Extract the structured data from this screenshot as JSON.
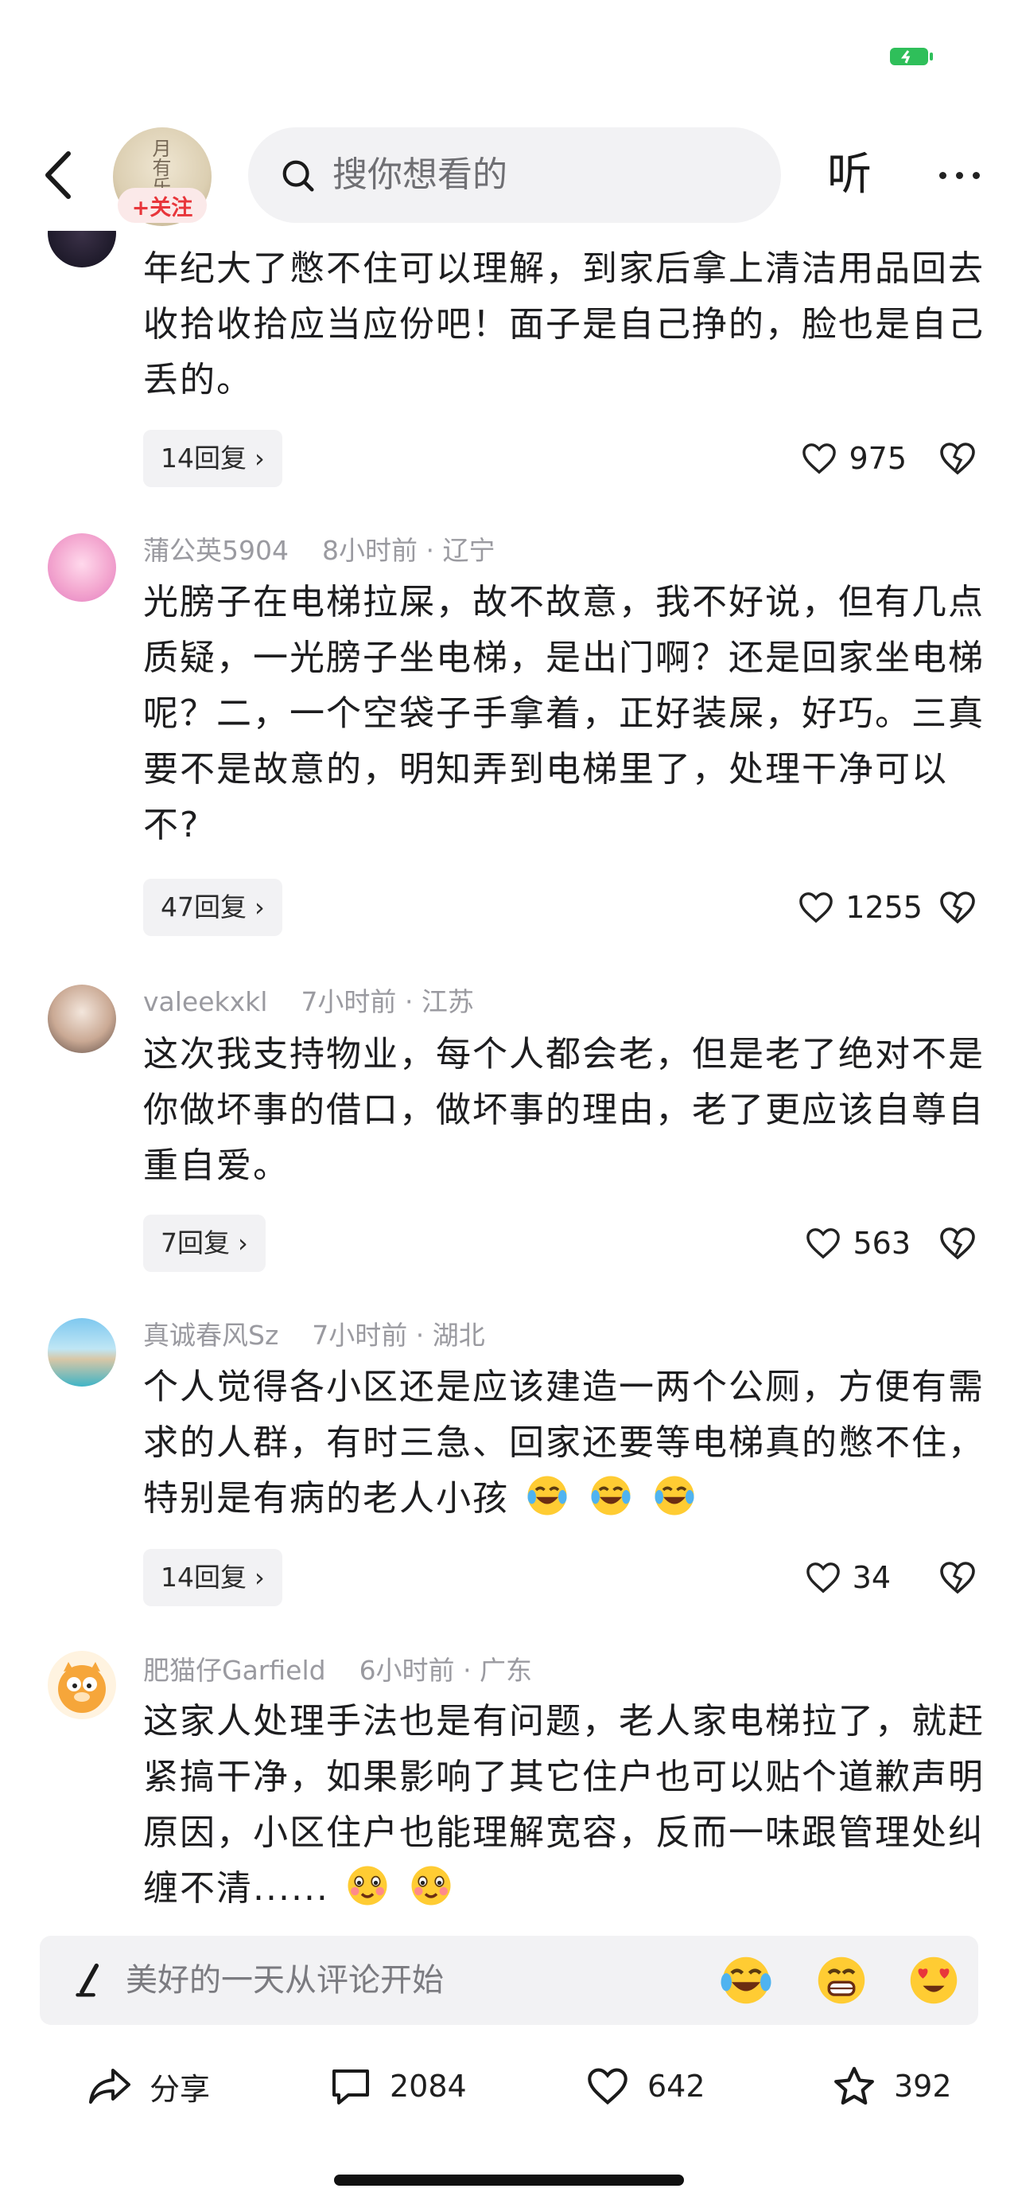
{
  "header": {
    "search_placeholder": "搜你想看的",
    "listen_label": "听",
    "follow_label": "+关注",
    "avatar_text": "月有乐"
  },
  "comments": [
    {
      "user": "",
      "time": "",
      "location": "",
      "text": "年纪大了憋不住可以理解，到家后拿上清洁用品回去收拾收拾应当应份吧！面子是自己挣的，脸也是自己丢的。",
      "replies": "14回复",
      "likes": "975"
    },
    {
      "user": "蒲公英5904",
      "time": "8小时前",
      "location": "辽宁",
      "text": "光膀子在电梯拉屎，故不故意，我不好说，但有几点质疑，一光膀子坐电梯，是出门啊？还是回家坐电梯呢？二，一个空袋子手拿着，正好装屎，好巧。三真要不是故意的，明知弄到电梯里了，处理干净可以不?",
      "replies": "47回复",
      "likes": "1255"
    },
    {
      "user": "valeekxkl",
      "time": "7小时前",
      "location": "江苏",
      "text": "这次我支持物业，每个人都会老，但是老了绝对不是你做坏事的借口，做坏事的理由，老了更应该自尊自重自爱。",
      "replies": "7回复",
      "likes": "563"
    },
    {
      "user": "真诚春风Sz",
      "time": "7小时前",
      "location": "湖北",
      "text": "个人觉得各小区还是应该建造一两个公厕，方便有需求的人群，有时三急、回家还要等电梯真的憋不住，特别是有病的老人小孩",
      "replies": "14回复",
      "likes": "34"
    },
    {
      "user": "肥猫仔Garfield",
      "time": "6小时前",
      "location": "广东",
      "text": "这家人处理手法也是有问题，老人家电梯拉了，就赶紧搞干净，如果影响了其它住户也可以贴个道歉声明原因，小区住户也能理解宽容，反而一味跟管理处纠缠不清......"
    }
  ],
  "input": {
    "placeholder": "美好的一天从评论开始"
  },
  "actions": {
    "share_label": "分享",
    "comments_count": "2084",
    "likes_count": "642",
    "favorites_count": "392"
  },
  "colors": {
    "accent_red": "#e8363b",
    "muted_text": "#9a9aa0",
    "chip_bg": "#f2f2f4",
    "battery_green": "#2fbf5a"
  },
  "icons": [
    "back-icon",
    "search-icon",
    "more-icon",
    "heart-icon",
    "dislike-icon",
    "pen-icon",
    "share-icon",
    "comment-icon",
    "star-icon",
    "laugh-cry-emoji",
    "grin-emoji",
    "heart-eyes-emoji",
    "woozy-emoji",
    "battery-icon"
  ]
}
